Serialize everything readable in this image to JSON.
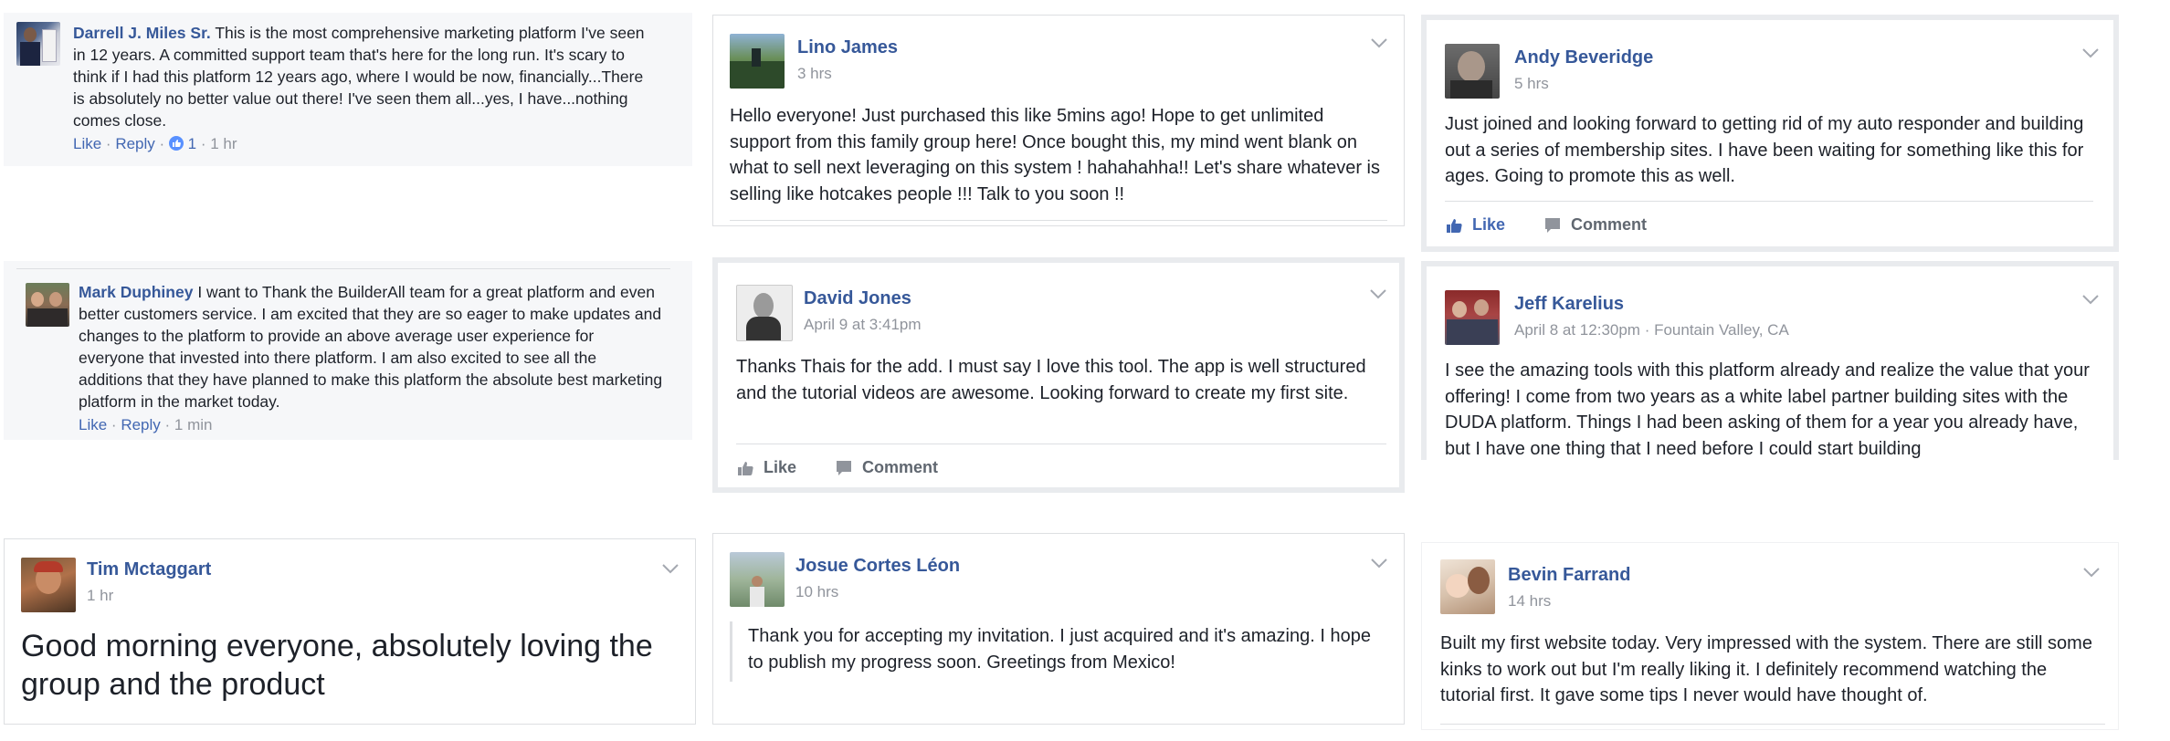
{
  "comments": [
    {
      "author": "Darrell J. Miles Sr.",
      "text": "This is the most comprehensive marketing platform I've seen in 12 years. A committed support team that's here for the long run. It's scary to think if I had this platform 12 years ago, where I would be now, financially...There is absolutely no better value out there! I've seen them all...yes, I have...nothing comes close.",
      "like": "Like",
      "reply": "Reply",
      "reaction_count": "1",
      "time": "1 hr"
    },
    {
      "author": "Mark Duphiney",
      "text": "I want to Thank the BuilderAll team for a great platform and even better customers service. I am excited that they are so eager to make updates and changes to the platform to provide an above average user experience for everyone that invested into there platform. I am also excited to see all the additions that they have planned to make this platform the absolute best marketing platform in the market today.",
      "like": "Like",
      "reply": "Reply",
      "time": "1 min"
    }
  ],
  "posts": [
    {
      "author": "Lino James",
      "meta": "3 hrs",
      "text": "Hello everyone! Just purchased this like 5mins ago! Hope to get unlimited support from this family group here! Once bought this, my mind went blank on what to sell next leveraging on this system ! hahahahha!! Let's share whatever is selling like hotcakes people !!! Talk to you soon !!"
    },
    {
      "author": "Andy Beveridge",
      "meta": "5 hrs",
      "text": "Just joined and looking forward to getting rid of my auto responder and building out a series of membership sites. I have been waiting for something like this for ages. Going to promote this as well.",
      "like": "Like",
      "comment": "Comment"
    },
    {
      "author": "David Jones",
      "meta": "April 9 at 3:41pm",
      "text": "Thanks Thais for the add. I must say I love this tool. The app is well structured and the tutorial videos are awesome. Looking forward to create my first site.",
      "like": "Like",
      "comment": "Comment"
    },
    {
      "author": "Jeff Karelius",
      "meta": "April 8 at 12:30pm · Fountain Valley, CA",
      "text": "I see the amazing tools with this platform already and realize the value that your offering! I come from two years as a white label partner building sites with the DUDA platform. Things I had been asking of them for a year you already have, but I have one thing that I need before I could start building"
    },
    {
      "author": "Tim Mctaggart",
      "meta": "1 hr",
      "text": "Good morning everyone, absolutely loving the group and the product"
    },
    {
      "author": "Josue Cortes Léon",
      "meta": "10 hrs",
      "text": "Thank you for accepting my invitation. I just acquired and it's amazing. I hope to publish my progress soon. Greetings from Mexico!"
    },
    {
      "author": "Bevin Farrand",
      "meta": "14 hrs",
      "text": "Built my first website today. Very impressed with the system. There are still some kinks to work out but I'm really liking it. I definitely recommend watching the tutorial first. It gave some tips I never would have thought of."
    }
  ],
  "colors": {
    "link": "#365899",
    "meta": "#90949c",
    "like_active": "#4267b2",
    "card_border": "#dddfe2"
  }
}
